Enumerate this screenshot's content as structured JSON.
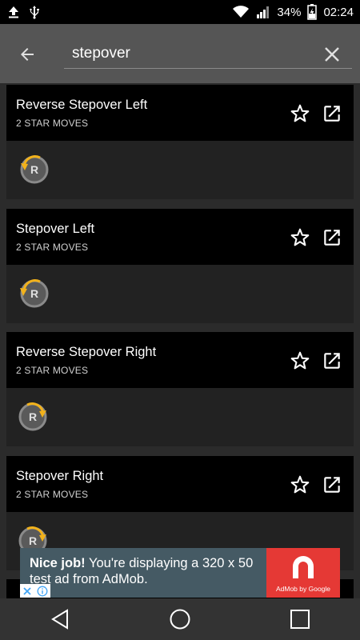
{
  "status_bar": {
    "battery_text": "34%",
    "time": "02:24"
  },
  "search": {
    "value": "stepover"
  },
  "moves": [
    {
      "title": "Reverse Stepover Left",
      "subtitle": "2 STAR MOVES",
      "direction": "left"
    },
    {
      "title": "Stepover Left",
      "subtitle": "2 STAR MOVES",
      "direction": "left"
    },
    {
      "title": "Reverse Stepover Right",
      "subtitle": "2 STAR MOVES",
      "direction": "right"
    },
    {
      "title": "Stepover Right",
      "subtitle": "2 STAR MOVES",
      "direction": "right"
    }
  ],
  "move_icon_letter": "R",
  "ad": {
    "headline": "Nice job!",
    "body": " You're displaying a 320 x 50 test ad from AdMob.",
    "brand": "AdMob by Google"
  },
  "colors": {
    "accent_arrow": "#f2b21b",
    "ad_background": "#455a64",
    "ad_logo": "#e53935"
  },
  "icons": {
    "back": "arrow-back-icon",
    "clear": "close-icon",
    "favorite": "star-outline-icon",
    "open": "open-in-new-icon",
    "nav_back": "triangle-back-icon",
    "nav_home": "circle-home-icon",
    "nav_recent": "square-recent-icon"
  }
}
